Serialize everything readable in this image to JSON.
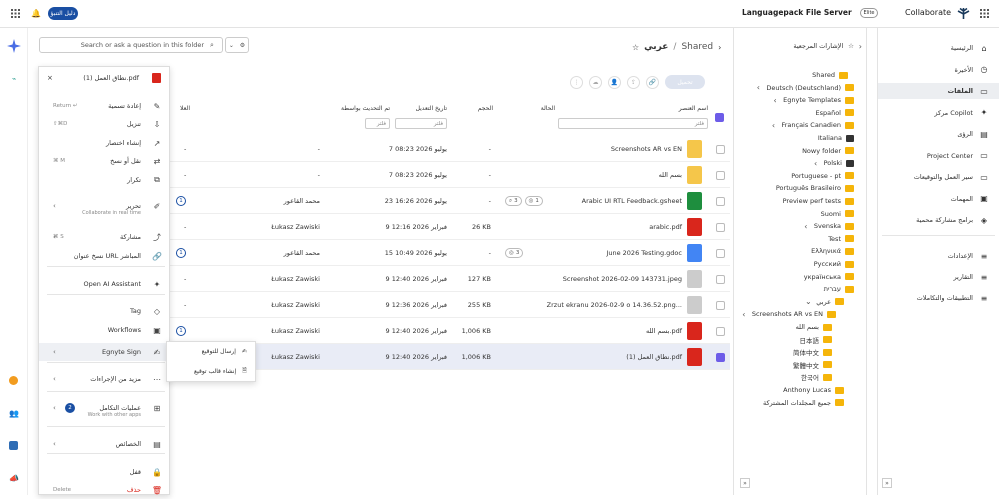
{
  "topbar": {
    "app_title": "Languagepack File Server",
    "brand": "Collaborate",
    "trial_pill": "دليل التنبؤ",
    "plan_badge": "Elite"
  },
  "search": {
    "placeholder": "Search or ask a question in this folder"
  },
  "breadcrumb": {
    "root": "Shared",
    "sep": "/",
    "current": "عربي"
  },
  "toolbar": {
    "upload_label": "تحميل"
  },
  "nav": {
    "items": [
      "الرئيسية",
      "الأخيرة",
      "الملفات",
      "مركز Copilot",
      "الرؤى",
      "Project Center",
      "سير العمل والتوقيعات",
      "المهمات",
      "برامج مشاركة محمية"
    ],
    "admin": [
      "الإعدادات",
      "التقارير",
      "التطبيقات والتكاملات"
    ]
  },
  "folders": {
    "title": "الإشارات المرجعية",
    "items": [
      "Shared",
      "Deutsch (Deutschland)",
      "Egnyte Templates",
      "Español",
      "Français Canadien",
      "Italiana",
      "Nowy folder",
      "Polski",
      "Portuguese - pt",
      "Português Brasileiro",
      "Preview perf tests",
      "Suomi",
      "Svenska",
      "Test",
      "Ελληνικά",
      "Русский",
      "українська",
      "עברית",
      "عربي",
      "Screenshots AR vs EN",
      "بسم الله",
      "日本語",
      "简体中文",
      "繁體中文",
      "한국어",
      "Anthony Lucas",
      "جميع المجلدات المشتركة"
    ]
  },
  "table": {
    "headers": {
      "name": "اسم العنصر",
      "status": "الحالة",
      "size": "الحجم",
      "modified": "تاريخ التعديل",
      "modified_by": "تم التحديث بواسطة",
      "tags": "العلا"
    },
    "filter_placeholder": "فلتر",
    "rows": [
      {
        "name": "Screenshots AR vs EN",
        "size": "-",
        "date": "7 يوليو 2026 08:23",
        "by": "-",
        "tag": "-"
      },
      {
        "name": "بسم الله",
        "size": "-",
        "date": "7 يوليو 2026 08:23",
        "by": "-",
        "tag": "-"
      },
      {
        "name": "Arabic UI RTL Feedback.gsheet",
        "chip1": "1",
        "chip2": "3",
        "size": "-",
        "date": "23 يوليو 2026 16:26",
        "by": "محمد القاعور",
        "tag": "1"
      },
      {
        "name": "arabic.pdf",
        "size": "26 KB",
        "date": "9 فبراير 2026 12:16",
        "by": "Łukasz Zawiski",
        "tag": "-"
      },
      {
        "name": "June 2026 Testing.gdoc",
        "chip1": "3",
        "size": "-",
        "date": "15 يوليو 2026 10:49",
        "by": "محمد القاعور",
        "tag": "1"
      },
      {
        "name": "Screenshot 2026-02-09 143731.jpeg",
        "size": "127 KB",
        "date": "9 فبراير 2026 12:40",
        "by": "Łukasz Zawiski",
        "tag": "-"
      },
      {
        "name": "Zrzut ekranu 2026-02-9 o 14.36.52.png...",
        "size": "255 KB",
        "date": "9 فبراير 2026 12:36",
        "by": "Łukasz Zawiski",
        "tag": "-"
      },
      {
        "name": "بسم الله.pdf",
        "size": "1,006 KB",
        "date": "9 فبراير 2026 12:40",
        "by": "Łukasz Zawiski",
        "tag": "1"
      },
      {
        "name": "نطاق العمل (1).pdf",
        "size": "1,006 KB",
        "date": "9 فبراير 2026 12:40",
        "by": "Łukasz Zawiski",
        "tag": "-"
      }
    ]
  },
  "menu": {
    "title": "نطاق العمل (1).pdf",
    "items": [
      {
        "label": "إعادة تسمية",
        "sc": "Return ↵"
      },
      {
        "label": "تنزيل",
        "sc": "⇧⌘D"
      },
      {
        "label": "إنشاء اختصار",
        "sc": ""
      },
      {
        "label": "نقل أو نسخ",
        "sc": "⌘ M"
      },
      {
        "label": "تكرار",
        "sc": ""
      },
      {
        "label": "تحرير",
        "sc": "",
        "sub": "Collaborate in real time"
      },
      {
        "label": "مشاركة",
        "sc": "⌘ S"
      },
      {
        "label": "نسخ عنوان URL المباشر",
        "sc": ""
      },
      {
        "label": "Open AI Assistant",
        "sc": ""
      },
      {
        "label": "Tag",
        "sc": ""
      },
      {
        "label": "Workflows",
        "sc": ""
      },
      {
        "label": "Egnyte Sign",
        "sc": ""
      },
      {
        "label": "مزيد من الإجراءات",
        "sc": ""
      },
      {
        "label": "عمليات التكامل",
        "sc": "",
        "sub": "Work with other apps"
      },
      {
        "label": "الخصائص",
        "sc": ""
      },
      {
        "label": "قفل",
        "sc": ""
      },
      {
        "label": "حذف",
        "sc": "Delete"
      }
    ],
    "integrations_count": "2"
  },
  "submenu": {
    "items": [
      "إرسال للتوقيع",
      "إنشاء قالب توقيع"
    ]
  },
  "colors": {
    "accent": "#6d5ce8",
    "brand": "#1a4fa3",
    "folder": "#f5b50a"
  }
}
